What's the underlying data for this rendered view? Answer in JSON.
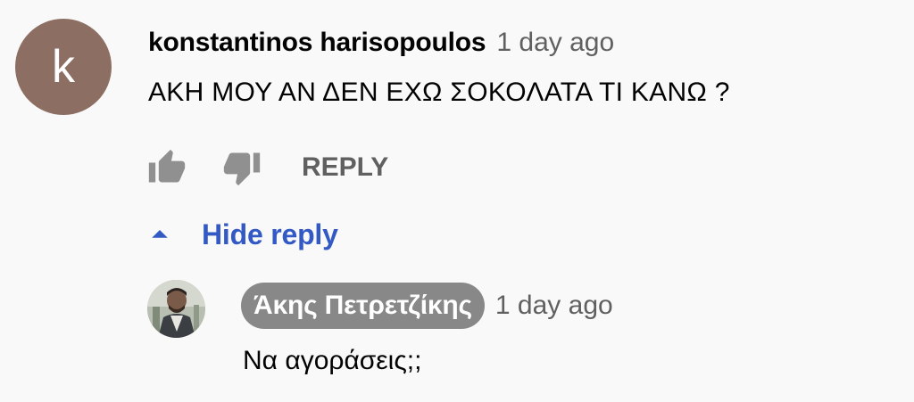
{
  "comment": {
    "avatar_letter": "k",
    "avatar_color": "#8d6e63",
    "author": "konstantinos harisopoulos",
    "time": "1 day ago",
    "text": "ΑΚΗ ΜΟΥ ΑΝ ΔΕΝ ΕΧΩ ΣΟΚΟΛΑΤΑ ΤΙ ΚΑΝΩ ?",
    "actions": {
      "like_icon": "thumbs-up-icon",
      "dislike_icon": "thumbs-down-icon",
      "reply_label": "REPLY"
    }
  },
  "replies_toggle": {
    "icon": "caret-up-icon",
    "label": "Hide reply",
    "color": "#3259c4"
  },
  "reply": {
    "avatar": "channel-owner-avatar-photo",
    "author": "Άκης Πετρετζίκης",
    "author_badge_color": "#888888",
    "time": "1 day ago",
    "text": "Να αγοράσεις;;"
  }
}
